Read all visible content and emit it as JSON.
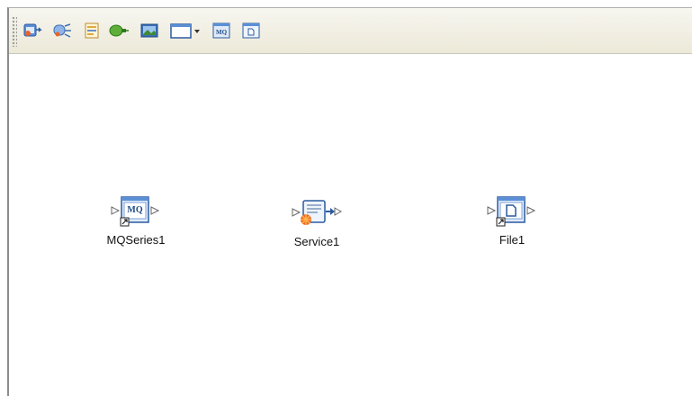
{
  "toolbar": {
    "items": [
      {
        "icon": "add-inbound-service-icon"
      },
      {
        "icon": "add-service-connector-icon"
      },
      {
        "icon": "edit-properties-icon"
      },
      {
        "icon": "add-adapter-icon"
      },
      {
        "icon": "add-image-icon"
      },
      {
        "icon": "window-dropdown-icon"
      },
      {
        "icon": "mqseries-adapter-icon"
      },
      {
        "icon": "file-adapter-icon"
      }
    ]
  },
  "canvas": {
    "nodes": [
      {
        "label": "MQSeries1",
        "icon": "mqseries-component-icon",
        "icon_text": "MQ"
      },
      {
        "label": "Service1",
        "icon": "service-component-icon"
      },
      {
        "label": "File1",
        "icon": "file-component-icon"
      }
    ]
  }
}
